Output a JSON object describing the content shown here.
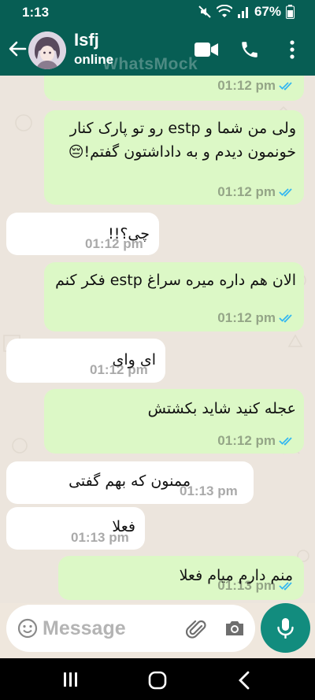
{
  "status_bar": {
    "time": "1:13",
    "battery": "67%"
  },
  "header": {
    "name": "Isfj",
    "status": "online",
    "watermark": "WhatsMock"
  },
  "messages": [
    {
      "dir": "out",
      "text": "",
      "time": "01:12 pm",
      "read": true
    },
    {
      "dir": "out",
      "text": "ولی من شما و estp رو تو پارک کنار خونمون دیدم و به داداشتون گفتم!😔",
      "time": "01:12 pm",
      "read": true
    },
    {
      "dir": "in",
      "text": "چی؟!!",
      "time": "01:12 pm"
    },
    {
      "dir": "out",
      "text": "الان هم داره میره سراغ estp فکر کنم",
      "time": "01:12 pm",
      "read": true
    },
    {
      "dir": "in",
      "text": "ای وای",
      "time": "01:12 pm"
    },
    {
      "dir": "out",
      "text": "عجله کنید شاید بکشتش",
      "time": "01:12 pm",
      "read": true
    },
    {
      "dir": "in",
      "text": "ممنون که بهم گفتی",
      "time": "01:13 pm"
    },
    {
      "dir": "in",
      "text": "فعلا",
      "time": "01:13 pm"
    },
    {
      "dir": "out",
      "text": "منم دارم میام فعلا",
      "time": "01:13 pm",
      "read": true
    }
  ],
  "composer": {
    "placeholder": "Message"
  },
  "colors": {
    "header": "#075e54",
    "outgoing": "#dcf8c6",
    "incoming": "#ffffff",
    "read_tick": "#34b7f1",
    "mic": "#128c7e"
  }
}
